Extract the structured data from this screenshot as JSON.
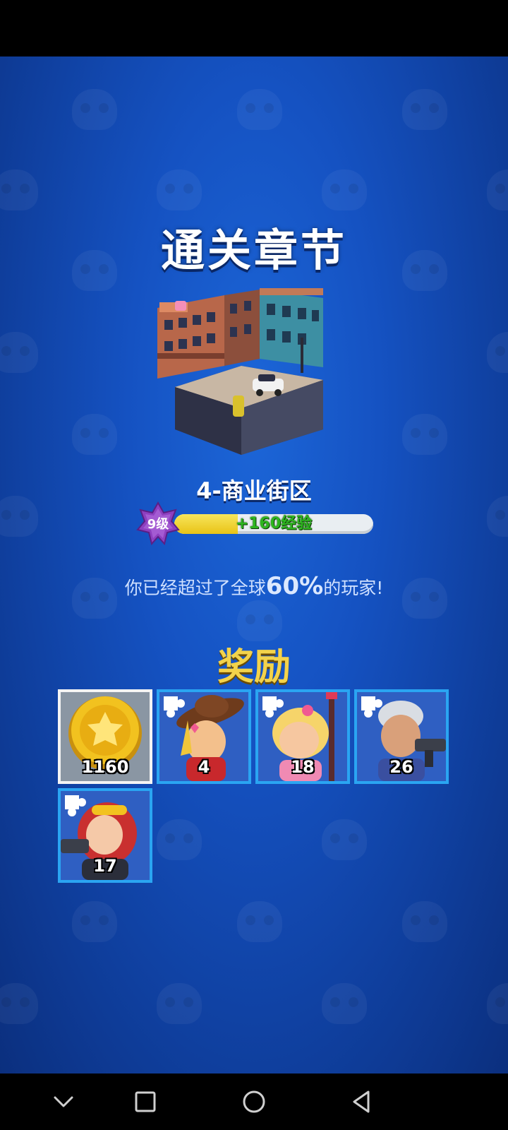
{
  "title": "通关章节",
  "chapter": {
    "name": "4-商业街区",
    "image_icon": "city-block-icon"
  },
  "level": {
    "label": "9级",
    "xp_gain": "+160经验",
    "xp_progress": 0.32
  },
  "rank": {
    "prefix": "你已经超过了全球",
    "percent": "60%",
    "suffix": "的玩家!"
  },
  "rewards": {
    "title": "奖励",
    "items": [
      {
        "type": "coin",
        "icon": "gold-coin-icon",
        "count": "1160"
      },
      {
        "type": "hero-fragment",
        "icon": "cowgirl-hero-fragment-icon",
        "count": "4"
      },
      {
        "type": "hero-fragment",
        "icon": "pink-girl-hero-fragment-icon",
        "count": "18"
      },
      {
        "type": "hero-fragment",
        "icon": "old-gunner-hero-fragment-icon",
        "count": "26"
      },
      {
        "type": "hero-fragment",
        "icon": "redhead-gunner-hero-fragment-icon",
        "count": "17"
      }
    ]
  },
  "nav": {
    "icons": [
      "chevron-down-icon",
      "square-icon",
      "circle-icon",
      "triangle-back-icon"
    ]
  }
}
